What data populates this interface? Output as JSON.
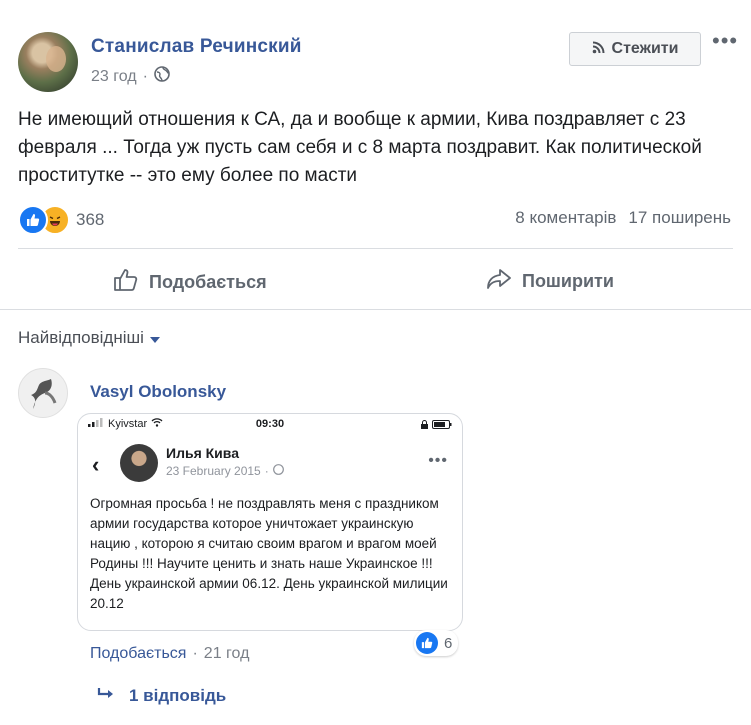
{
  "post": {
    "author": "Станислав Речинский",
    "time": "23 год",
    "follow_label": "Стежити",
    "text": "Не имеющий отношения к СА, да и вообще к армии, Кива поздравляет с 23 февраля ... Тогда уж пусть сам себя и с 8 марта поздравит. Как политической проститутке -- это ему более по масти",
    "reaction_count": "368",
    "comments_count": "8 коментарів",
    "shares_count": "17 поширень",
    "like_label": "Подобається",
    "share_label": "Поширити",
    "icons": [
      "globe-icon",
      "rss-icon",
      "like-icon",
      "haha-icon",
      "thumb-up-outline-icon",
      "share-arrow-icon"
    ]
  },
  "comments_section": {
    "sort_label": "Найвідповідніші"
  },
  "comment": {
    "author": "Vasyl Obolonsky",
    "like_label": "Подобається",
    "separator": "·",
    "time": "21 год",
    "likes": "6",
    "replies_label": "1 відповідь",
    "screenshot": {
      "carrier": "Kyivstar",
      "clock": "09:30",
      "name": "Илья Кива",
      "date": "23 February 2015",
      "text": "Огромная просьба ! не поздравлять меня с праздником армии государства которое уничтожает украинскую нацию , которою я считаю своим врагом и врагом моей Родины !!! Научите ценить и знать наше Украинское !!! День украинской армии 06.12. День украинской милиции 20.12"
    }
  },
  "colors": {
    "link_blue": "#385898",
    "like_blue": "#1877f2",
    "haha_yellow": "#f7b125",
    "secondary_text": "#606770"
  }
}
